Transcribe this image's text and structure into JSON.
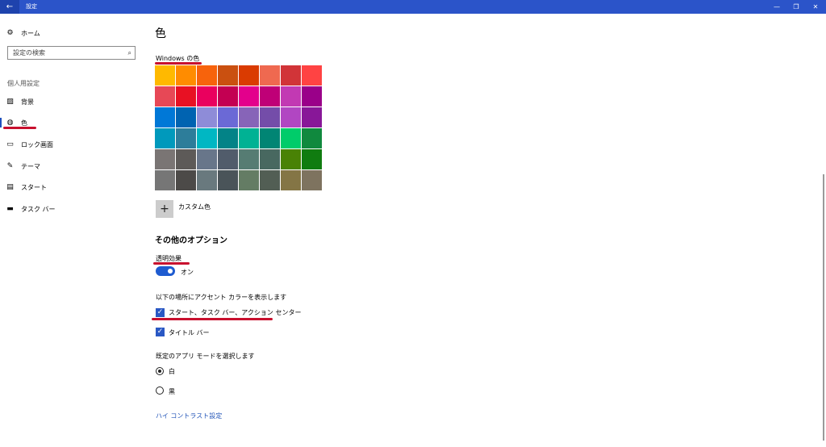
{
  "titlebar": {
    "back_icon": "←",
    "title": "設定",
    "minimize": "—",
    "restore": "❐",
    "close": "✕"
  },
  "sidebar": {
    "home": {
      "icon": "⚙",
      "label": "ホーム"
    },
    "search": {
      "placeholder": "設定の検索",
      "icon": "⌕"
    },
    "section": "個人用設定",
    "items": [
      {
        "icon": "▨",
        "label": "背景"
      },
      {
        "icon": "◍",
        "label": "色",
        "selected": true
      },
      {
        "icon": "▭",
        "label": "ロック画面"
      },
      {
        "icon": "✎",
        "label": "テーマ"
      },
      {
        "icon": "▤",
        "label": "スタート"
      },
      {
        "icon": "▬",
        "label": "タスク バー"
      }
    ]
  },
  "main": {
    "title": "色",
    "windows_color_label": "Windows の色",
    "swatch_colors": [
      "#ffb900",
      "#ff8c00",
      "#f7630c",
      "#ca5010",
      "#da3b01",
      "#ef6950",
      "#d13438",
      "#ff4343",
      "#e74856",
      "#e81123",
      "#ea005e",
      "#c30052",
      "#e3008c",
      "#bf0077",
      "#c239b3",
      "#9a0089",
      "#0078d7",
      "#0063b1",
      "#8e8cd8",
      "#6b69d6",
      "#8764b8",
      "#744da9",
      "#b146c2",
      "#881798",
      "#0099bc",
      "#2d7d9a",
      "#00b7c3",
      "#038387",
      "#00b294",
      "#018574",
      "#00cc6a",
      "#10893e",
      "#7a7574",
      "#5d5a58",
      "#68768a",
      "#515c6b",
      "#567c73",
      "#486860",
      "#498205",
      "#107c10",
      "#767676",
      "#4c4a48",
      "#69797e",
      "#4a5459",
      "#647c64",
      "#525e54",
      "#847545",
      "#7e735f"
    ],
    "custom_color": {
      "icon": "+",
      "label": "カスタム色"
    },
    "other_options": "その他のオプション",
    "transparency": {
      "label": "透明効果",
      "state": "オン"
    },
    "accent_surfaces_label": "以下の場所にアクセント カラーを表示します",
    "checkboxes": [
      {
        "label": "スタート、タスク バー、アクション センター",
        "checked": true
      },
      {
        "label": "タイトル バー",
        "checked": true
      }
    ],
    "app_mode_label": "既定のアプリ モードを選択します",
    "radios": [
      {
        "label": "白",
        "selected": true
      },
      {
        "label": "黒",
        "selected": false
      }
    ],
    "high_contrast_link": "ハイ コントラスト設定"
  },
  "colors": {
    "accent": "#2b54c9",
    "annotation": "#c8102e"
  }
}
